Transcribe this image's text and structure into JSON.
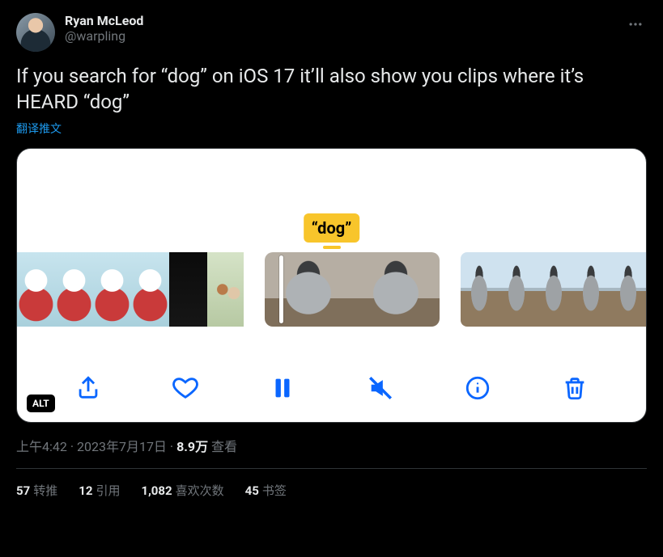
{
  "author": {
    "display_name": "Ryan McLeod",
    "handle": "@warpling"
  },
  "body_text": "If you search for “dog” on iOS 17 it’ll also show you clips where it’s HEARD “dog”",
  "translate_label": "翻译推文",
  "media": {
    "search_tag": "“dog”",
    "alt_badge": "ALT",
    "toolbar": {
      "share": "share",
      "like": "like",
      "pause": "pause",
      "mute": "mute",
      "info": "info",
      "delete": "delete"
    }
  },
  "meta": {
    "time": "上午4:42",
    "date": "2023年7月17日",
    "views_count": "8.9万",
    "views_label": "查看"
  },
  "stats": {
    "retweets": {
      "count": "57",
      "label": "转推"
    },
    "quotes": {
      "count": "12",
      "label": "引用"
    },
    "likes": {
      "count": "1,082",
      "label": "喜欢次数"
    },
    "bookmarks": {
      "count": "45",
      "label": "书签"
    }
  }
}
